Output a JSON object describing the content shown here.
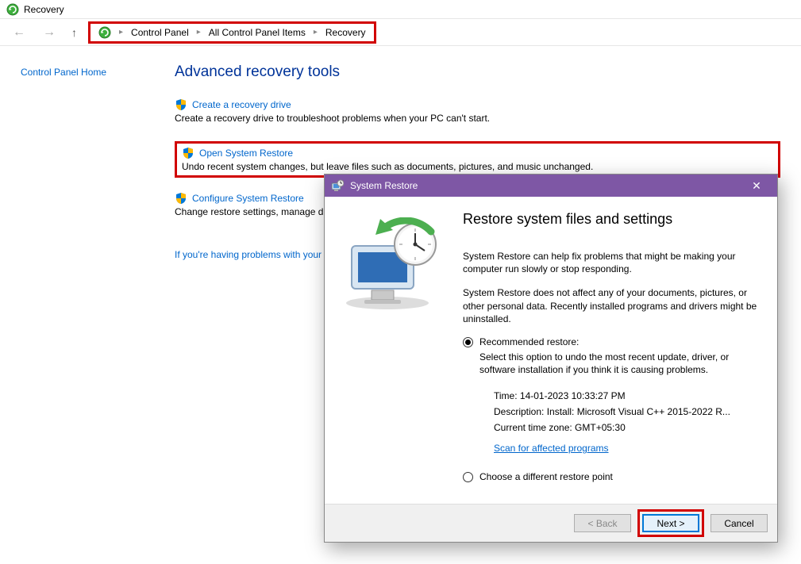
{
  "window": {
    "title": "Recovery"
  },
  "breadcrumb": {
    "items": [
      "Control Panel",
      "All Control Panel Items",
      "Recovery"
    ]
  },
  "sidebar": {
    "home_link": "Control Panel Home"
  },
  "page": {
    "title": "Advanced recovery tools",
    "tools": [
      {
        "link": "Create a recovery drive",
        "desc": "Create a recovery drive to troubleshoot problems when your PC can't start."
      },
      {
        "link": "Open System Restore",
        "desc": "Undo recent system changes, but leave files such as documents, pictures, and music unchanged."
      },
      {
        "link": "Configure System Restore",
        "desc": "Change restore settings, manage dis"
      }
    ],
    "help": "If you're having problems with your"
  },
  "dialog": {
    "title": "System Restore",
    "heading": "Restore system files and settings",
    "p1": "System Restore can help fix problems that might be making your computer run slowly or stop responding.",
    "p2": "System Restore does not affect any of your documents, pictures, or other personal data. Recently installed programs and drivers might be uninstalled.",
    "option1": {
      "label": "Recommended restore:",
      "sub": "Select this option to undo the most recent update, driver, or software installation if you think it is causing problems.",
      "time": "Time: 14-01-2023 10:33:27 PM",
      "desc": "Description: Install: Microsoft Visual C++ 2015-2022 R...",
      "tz": "Current time zone: GMT+05:30",
      "scan": "Scan for affected programs"
    },
    "option2": {
      "label": "Choose a different restore point"
    },
    "buttons": {
      "back": "< Back",
      "next": "Next >",
      "cancel": "Cancel"
    }
  }
}
